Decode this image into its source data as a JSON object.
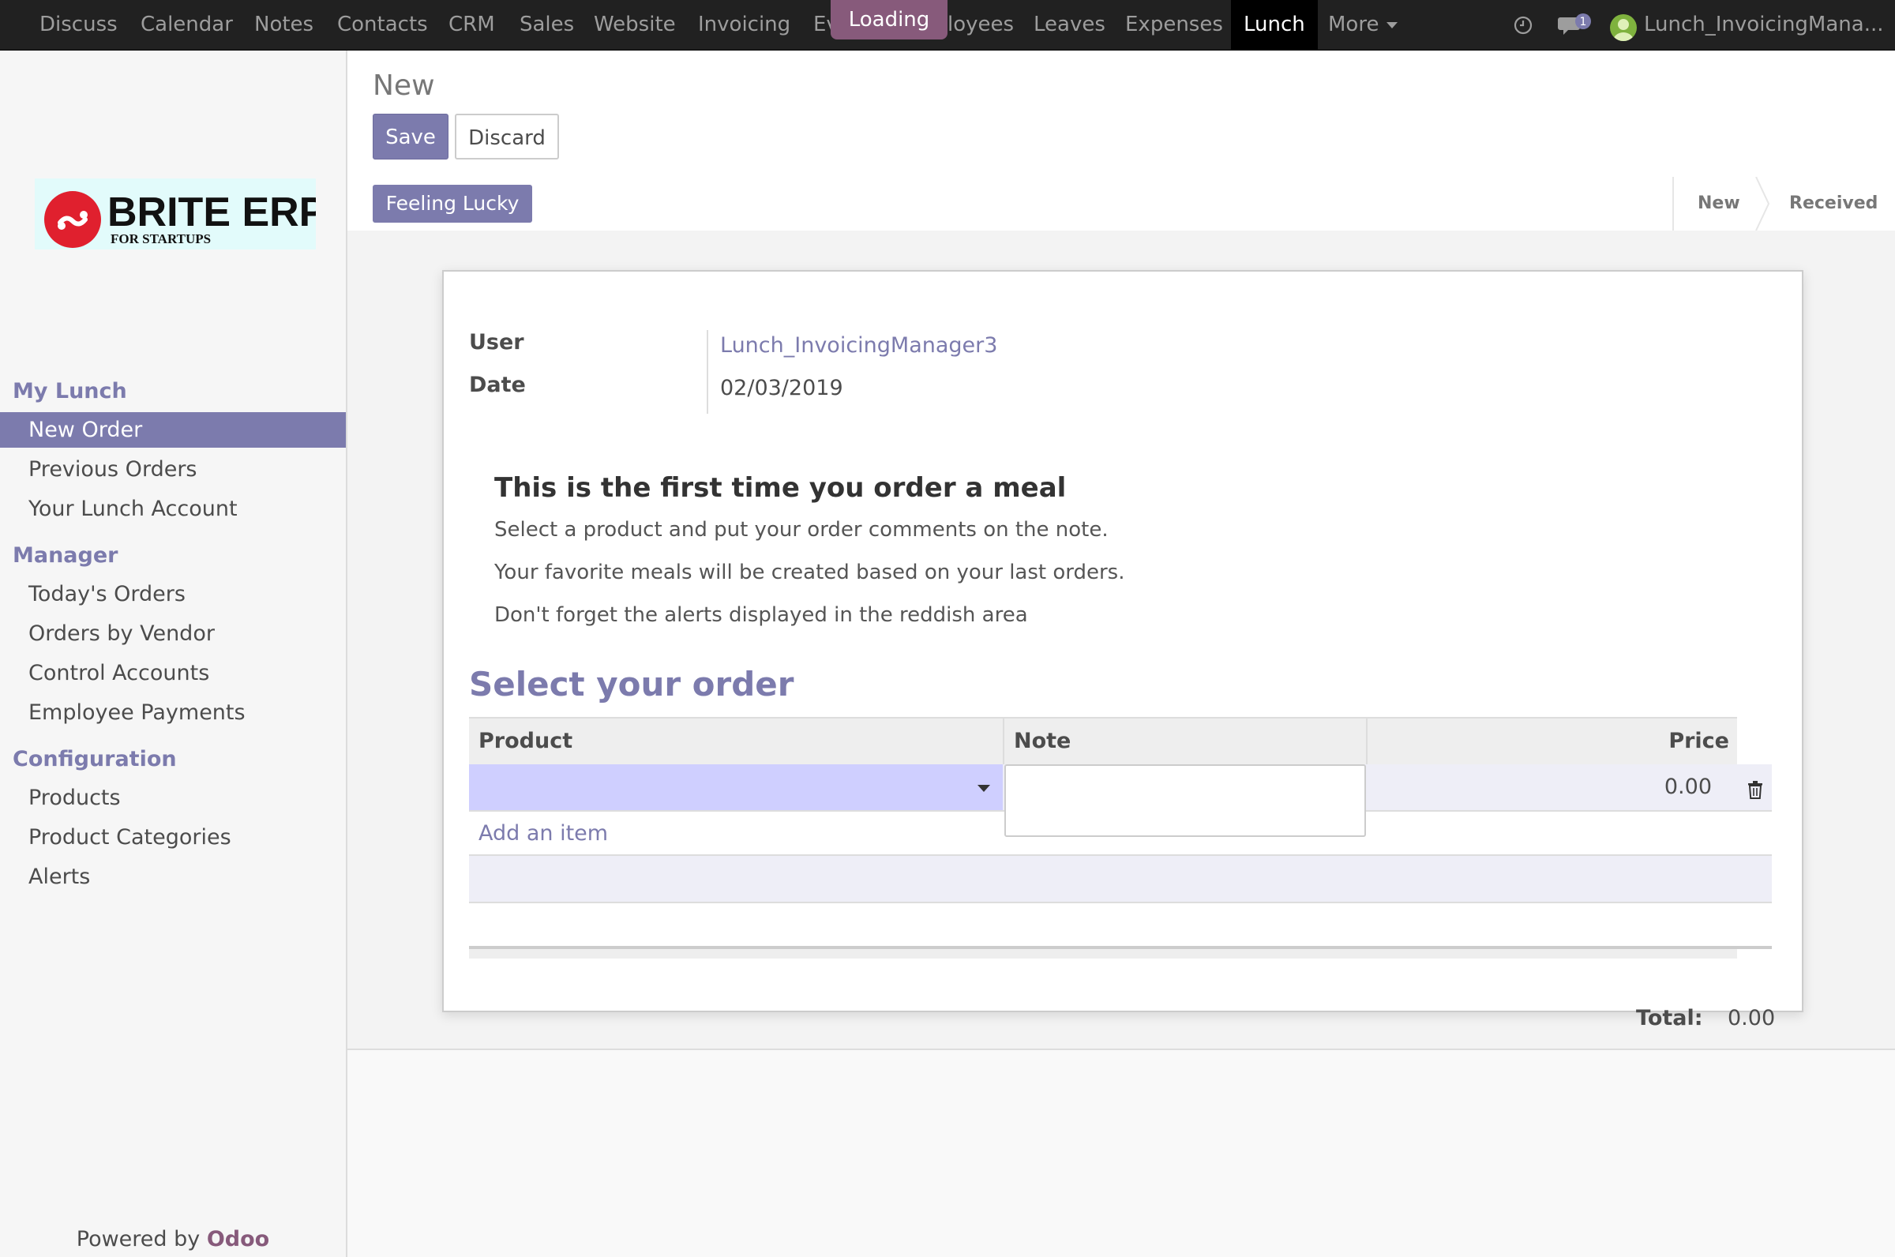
{
  "topbar": {
    "menu": [
      "Discuss",
      "Calendar",
      "Notes",
      "Contacts",
      "CRM",
      "Sales",
      "Website",
      "Invoicing",
      "Ev",
      "loyees",
      "Leaves",
      "Expenses",
      "Lunch",
      "More"
    ],
    "active_menu": "Lunch",
    "loading": "Loading",
    "chat_badge": "1",
    "user": "Lunch_InvoicingMana...",
    "icons": [
      "clock-icon",
      "chat-icon",
      "avatar"
    ]
  },
  "sidebar": {
    "logo_text": "BRITE ERP",
    "logo_subtext": "FOR STARTUPS",
    "sections": [
      {
        "title": "My Lunch",
        "items": [
          "New Order",
          "Previous Orders",
          "Your Lunch Account"
        ]
      },
      {
        "title": "Manager",
        "items": [
          "Today's Orders",
          "Orders by Vendor",
          "Control Accounts",
          "Employee Payments"
        ]
      },
      {
        "title": "Configuration",
        "items": [
          "Products",
          "Product Categories",
          "Alerts"
        ]
      }
    ],
    "active_item": "New Order",
    "powered_by": "Powered by",
    "powered_brand": "Odoo"
  },
  "control": {
    "breadcrumb": "New",
    "save_label": "Save",
    "discard_label": "Discard"
  },
  "statusbar": {
    "lucky_label": "Feeling Lucky",
    "stages": [
      "New",
      "Received"
    ]
  },
  "form": {
    "user_label": "User",
    "user_value": "Lunch_InvoicingManager3",
    "date_label": "Date",
    "date_value": "02/03/2019",
    "info_title": "This is the first time you order a meal",
    "info_lines": [
      "Select a product and put your order comments on the note.",
      "Your favorite meals will be created based on your last orders.",
      "Don't forget the alerts displayed in the reddish area"
    ],
    "section_title": "Select your order",
    "columns": [
      "Product",
      "Note",
      "Price"
    ],
    "row": {
      "product": "",
      "note": "",
      "price": "0.00"
    },
    "add_item": "Add an item",
    "total_label": "Total:",
    "total_value": "0.00"
  },
  "colors": {
    "brand": "#7c7bad",
    "topbar": "#212121",
    "odoo": "#875a7b"
  }
}
